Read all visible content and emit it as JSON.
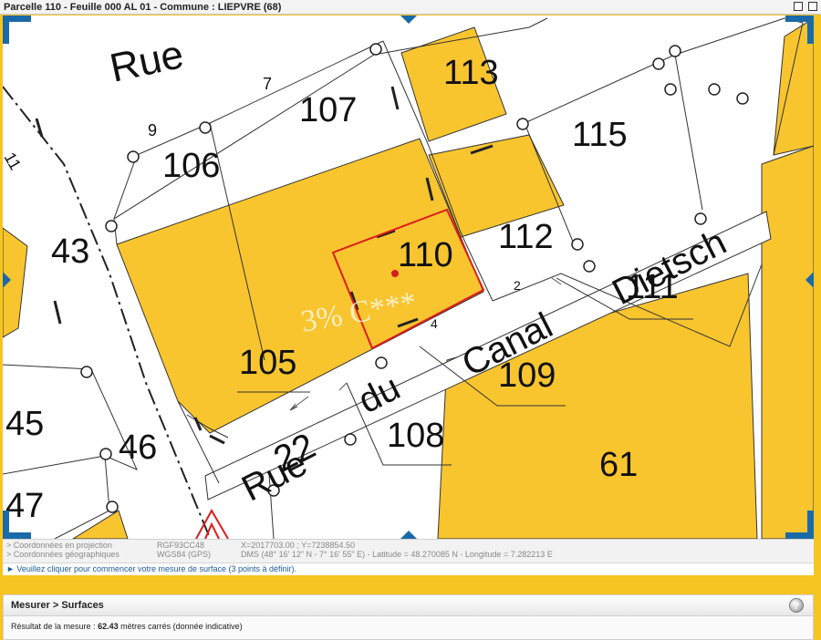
{
  "window": {
    "title": "Parcelle 110 - Feuille 000 AL 01 - Commune : LIEPVRE (68)"
  },
  "map": {
    "street_labels": [
      "Rue",
      "Rue",
      "du",
      "Canal",
      "Dietsch"
    ],
    "parcels": [
      "113",
      "107",
      "115",
      "106",
      "43",
      "110",
      "112",
      "111",
      "105",
      "109",
      "108",
      "45",
      "46",
      "61",
      "47"
    ],
    "house_numbers": [
      "7",
      "9",
      "11",
      "2",
      "4",
      "22"
    ],
    "watermark": "3% C***",
    "colors": {
      "built": "#f8c52f",
      "selection": "#e01b1b",
      "pan": "#1a6aa8"
    }
  },
  "coords": {
    "proj_label": "> Coordonnées en projection",
    "proj_system": "RGF93CC48",
    "proj_value": "X=2017703.00 ; Y=7238854.50",
    "geo_label": "> Coordonnées géographiques",
    "geo_system": "WGS84 (GPS)",
    "geo_value": "DMS (48° 16' 12\" N - 7° 16' 55\" E) - Latitude = 48.270085 N - Longitude = 7.282213 E"
  },
  "instruction": "► Veuillez cliquer pour commencer votre mesure de surface (3 points à définir).",
  "panel": {
    "title": "Mesurer > Surfaces",
    "help": "?",
    "result_label": "Résultat de la mesure :",
    "result_value": "62.43",
    "result_unit": "mètres carrés (donnée indicative)"
  }
}
